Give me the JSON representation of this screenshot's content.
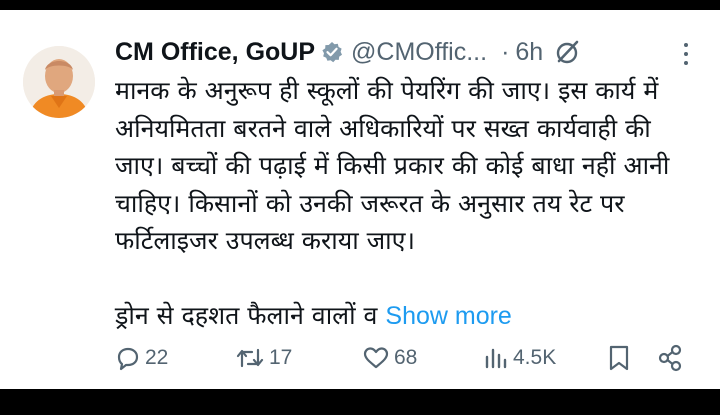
{
  "tweet": {
    "author_name": "CM Office, GoUP",
    "handle": "@CMOffic...",
    "separator": "·",
    "time": "6h",
    "body_lines": [
      "मानक के अनुरूप ही स्कूलों की पेयरिंग की जाए। इस कार्य में",
      "अनियमितता बरतने वाले अधिकारियों पर सख्त कार्यवाही की",
      "जाए। बच्चों की पढ़ाई में किसी प्रकार की कोई बाधा नहीं आनी",
      "चाहिए। किसानों को उनकी जरूरत के अनुसार तय रेट पर",
      "फर्टिलाइजर उपलब्ध कराया जाए।"
    ],
    "last_line": "ड्रोन से दहशत फैलाने वालों व ",
    "show_more": "Show more",
    "replies": "22",
    "reposts": "17",
    "likes": "68",
    "views": "4.5K"
  },
  "icons": [
    "verified-badge-icon",
    "grok-icon",
    "more-icon",
    "reply-icon",
    "repost-icon",
    "like-icon",
    "views-icon",
    "bookmark-icon",
    "share-icon"
  ],
  "colors": {
    "text": "#0f1419",
    "muted": "#536471",
    "link": "#1d9bf0",
    "background": "#ffffff"
  }
}
